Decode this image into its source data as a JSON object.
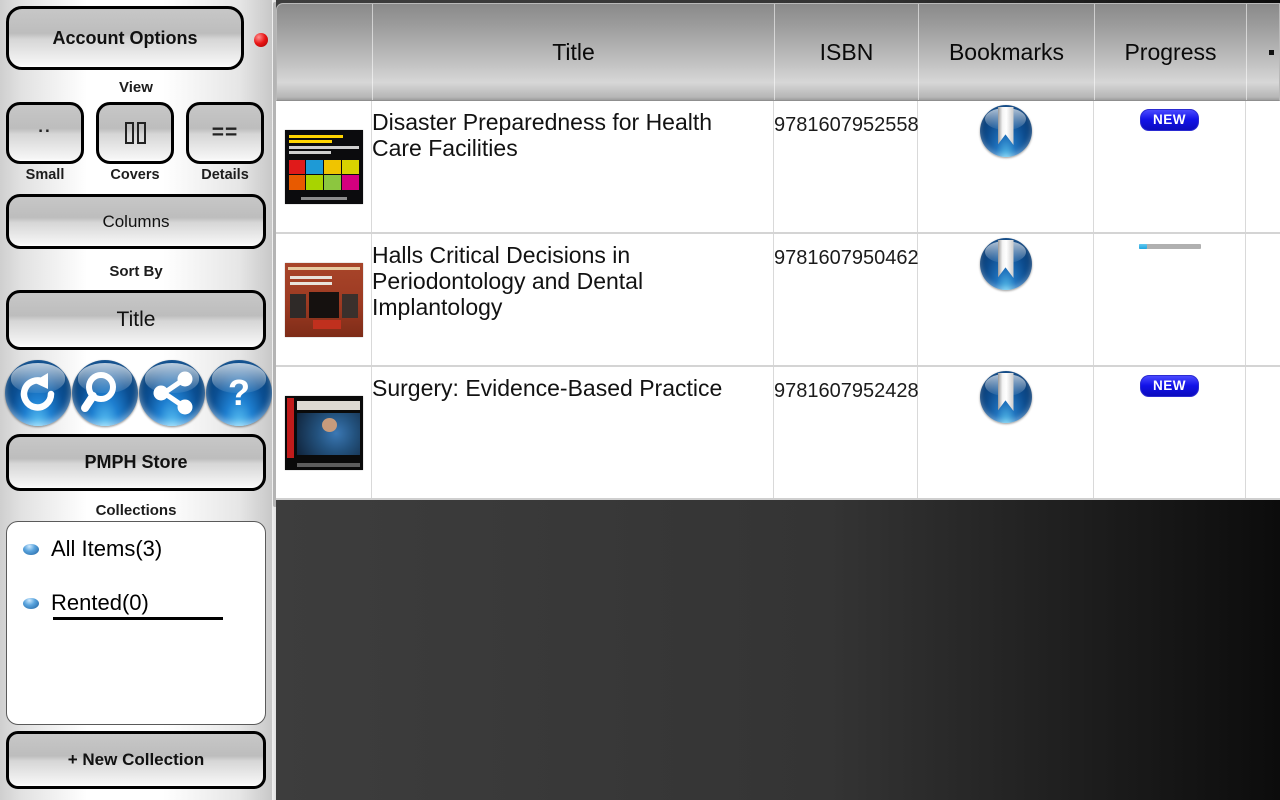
{
  "sidebar": {
    "account_options_label": "Account Options",
    "record_indicator_color": "#e81414",
    "view": {
      "label": "View",
      "options": [
        {
          "caption": "Small",
          "icon": "small-dots-icon",
          "glyph": ".."
        },
        {
          "caption": "Covers",
          "icon": "covers-bars-icon",
          "glyph": "▯▯"
        },
        {
          "caption": "Details",
          "icon": "details-equals-icon",
          "glyph": "=="
        }
      ]
    },
    "columns_label": "Columns",
    "sort_by": {
      "label": "Sort By",
      "value": "Title"
    },
    "action_icons": [
      {
        "name": "refresh-icon",
        "title": "Refresh"
      },
      {
        "name": "search-icon",
        "title": "Search"
      },
      {
        "name": "share-icon",
        "title": "Share"
      },
      {
        "name": "help-icon",
        "title": "Help"
      }
    ],
    "store_label": "PMPH Store",
    "collections": {
      "label": "Collections",
      "items": [
        {
          "label": "All Items(3)",
          "selected": false
        },
        {
          "label": "Rented(0)",
          "selected": true
        }
      ]
    },
    "new_collection_label": "+ New Collection"
  },
  "table": {
    "columns": [
      {
        "key": "cover",
        "label": ""
      },
      {
        "key": "title",
        "label": "Title"
      },
      {
        "key": "isbn",
        "label": "ISBN"
      },
      {
        "key": "bookmarks",
        "label": "Bookmarks"
      },
      {
        "key": "progress",
        "label": "Progress"
      },
      {
        "key": "extra",
        "label": ""
      }
    ],
    "rows": [
      {
        "cover": "disaster-preparedness-cover",
        "title": "Disaster Preparedness for Health Care Facilities",
        "isbn": "9781607952558",
        "bookmark_icon": "bookmark-icon",
        "progress_type": "badge",
        "progress_badge": "NEW",
        "progress_percent": 0
      },
      {
        "cover": "periodontology-cover",
        "title": "Halls Critical Decisions in Periodontology and Dental Implantology",
        "isbn": "9781607950462",
        "bookmark_icon": "bookmark-icon",
        "progress_type": "bar",
        "progress_badge": "",
        "progress_percent": 14
      },
      {
        "cover": "surgery-cover",
        "title": "Surgery: Evidence-Based Practice",
        "isbn": "9781607952428",
        "bookmark_icon": "bookmark-icon",
        "progress_type": "badge",
        "progress_badge": "NEW",
        "progress_percent": 0
      }
    ]
  },
  "colors": {
    "badge_new": "#1212e8",
    "progress_fill": "#1ea5e0",
    "icon_blue": "#1f72bd",
    "empty_area": "#3d3d3d"
  }
}
